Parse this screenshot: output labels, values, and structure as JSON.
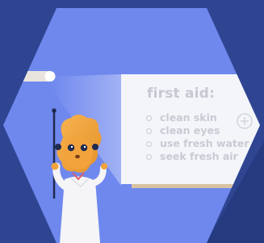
{
  "board": {
    "title": "first aid:",
    "items": [
      "clean skin",
      "clean eyes",
      "use fresh water",
      "seek fresh air"
    ]
  },
  "colors": {
    "dark_blue": "#2f4592",
    "hex_blue": "#6f88ee",
    "board": "#f4f5f9",
    "board_text": "#c6c8d2",
    "character_orange": "#f2a33c"
  },
  "icons": [
    "plus-circle-icon",
    "pointer-stick-icon",
    "lion-character-icon"
  ]
}
